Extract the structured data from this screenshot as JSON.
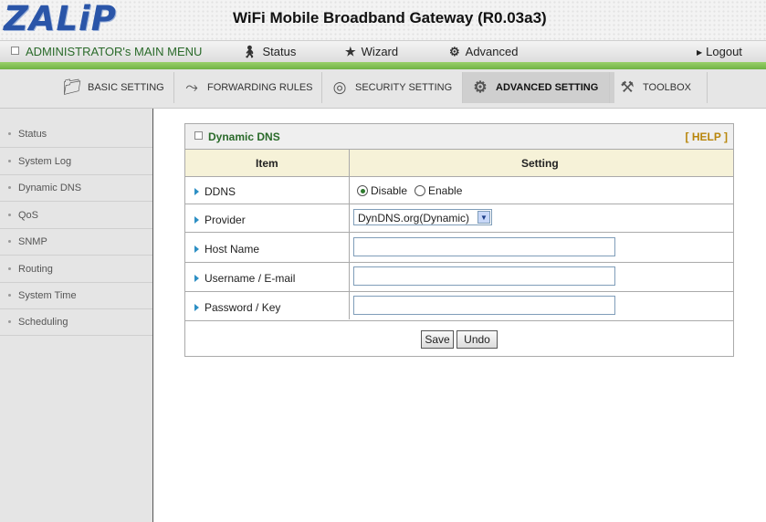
{
  "header": {
    "logo": "ZALiP",
    "title": "WiFi Mobile Broadband Gateway (R0.03a3)"
  },
  "menu": {
    "main_menu": "ADMINISTRATOR's MAIN MENU",
    "status": "Status",
    "wizard": "Wizard",
    "advanced": "Advanced",
    "logout": "Logout"
  },
  "tabs": [
    {
      "label": "BASIC SETTING"
    },
    {
      "label": "FORWARDING RULES"
    },
    {
      "label": "SECURITY SETTING"
    },
    {
      "label": "ADVANCED SETTING"
    },
    {
      "label": "TOOLBOX"
    }
  ],
  "sidebar": {
    "items": [
      {
        "label": "Status"
      },
      {
        "label": "System Log"
      },
      {
        "label": "Dynamic DNS"
      },
      {
        "label": "QoS"
      },
      {
        "label": "SNMP"
      },
      {
        "label": "Routing"
      },
      {
        "label": "System Time"
      },
      {
        "label": "Scheduling"
      }
    ]
  },
  "panel": {
    "title": "Dynamic DNS",
    "help": "[ HELP ]",
    "col_item": "Item",
    "col_setting": "Setting",
    "ddns_label": "DDNS",
    "ddns_disable": "Disable",
    "ddns_enable": "Enable",
    "ddns_selected": "Disable",
    "provider_label": "Provider",
    "provider_value": "DynDNS.org(Dynamic)",
    "hostname_label": "Host Name",
    "hostname_value": "",
    "username_label": "Username / E-mail",
    "username_value": "",
    "password_label": "Password / Key",
    "password_value": "",
    "save": "Save",
    "undo": "Undo"
  },
  "colors": {
    "brand": "#2a55a8",
    "green": "#6fb244",
    "title_green": "#2a6a2a",
    "help": "#b8860b"
  }
}
